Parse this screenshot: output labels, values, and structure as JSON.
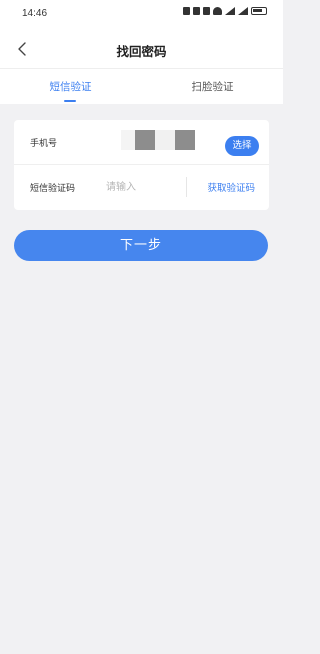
{
  "status_bar": {
    "time": "14:46"
  },
  "header": {
    "title": "找回密码",
    "back_icon": "chevron-left-icon"
  },
  "tabs": [
    {
      "label": "短信验证",
      "active": true
    },
    {
      "label": "扫脸验证",
      "active": false
    }
  ],
  "form": {
    "phone_label": "手机号",
    "select_button": "选择",
    "code_label": "短信验证码",
    "code_placeholder": "请输入",
    "code_value": "",
    "get_code_button": "获取验证码"
  },
  "next_button": "下一步",
  "colors": {
    "accent": "#3c7ff0",
    "background": "#f1f1f3",
    "card": "#ffffff"
  }
}
